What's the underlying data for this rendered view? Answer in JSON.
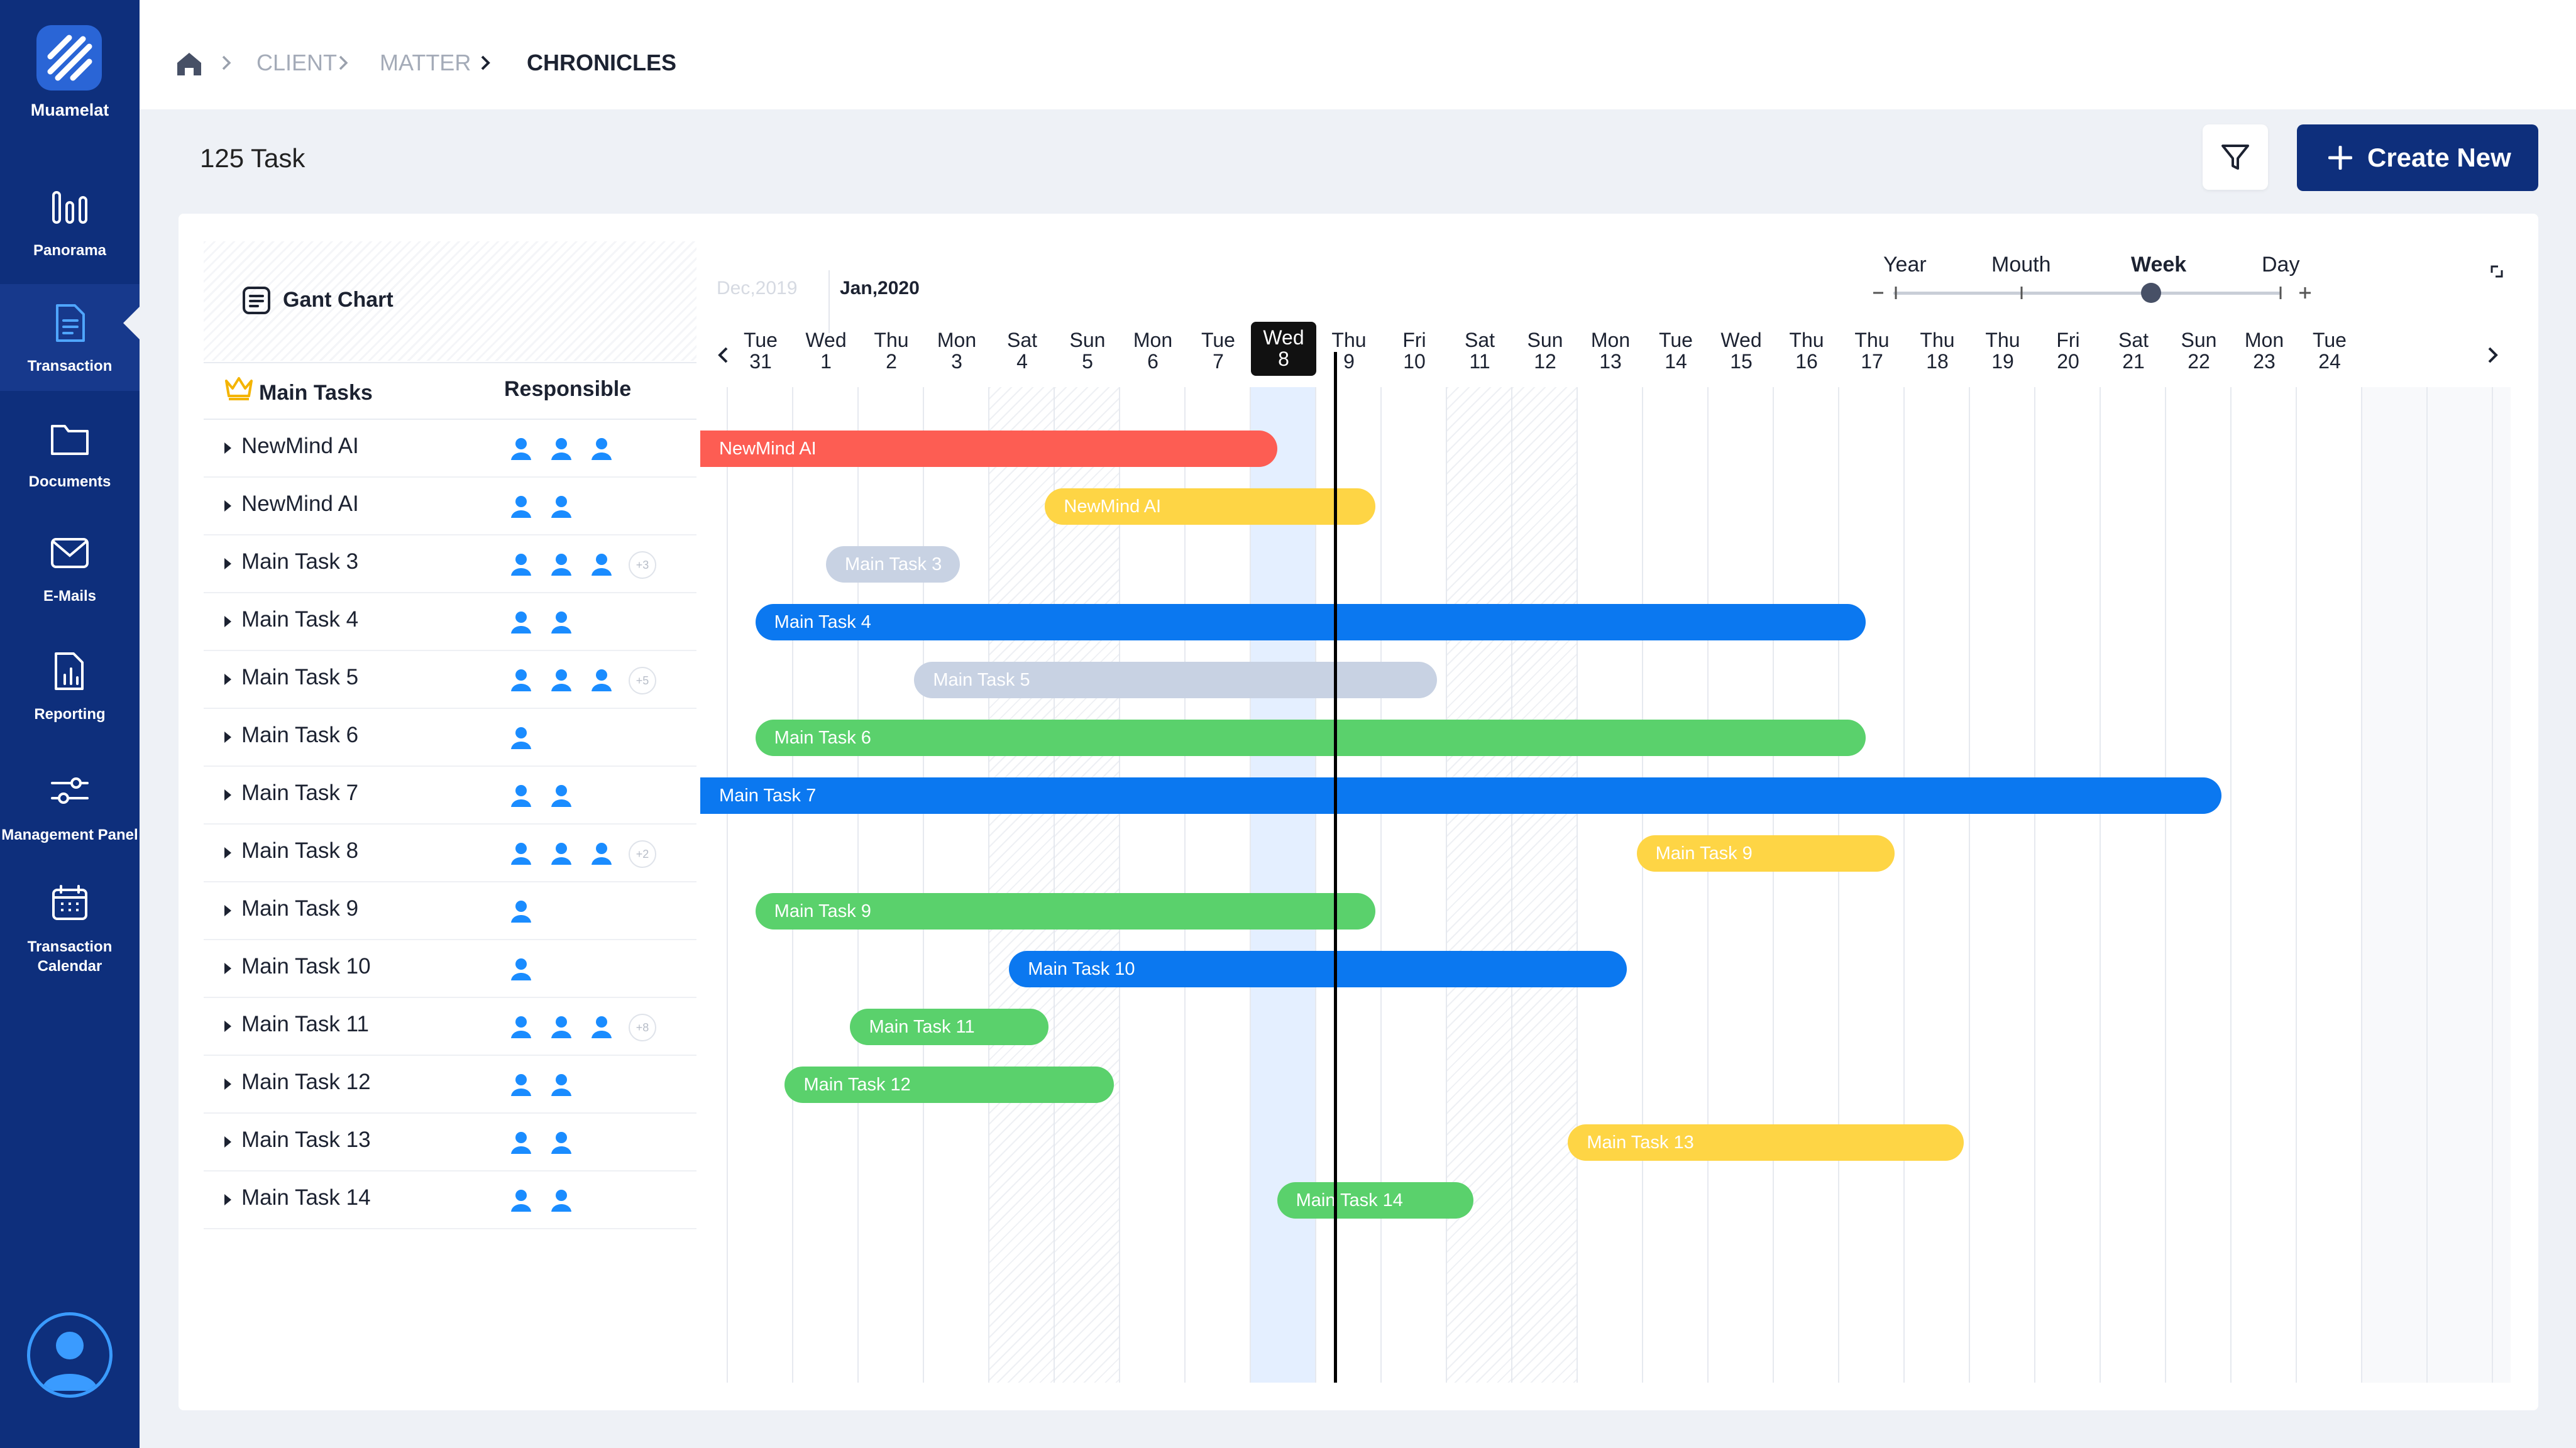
{
  "app": {
    "name": "Muamelat"
  },
  "sidebar": {
    "items": [
      {
        "label": "Panorama",
        "icon": "bar-chart-icon"
      },
      {
        "label": "Transaction",
        "icon": "document-icon"
      },
      {
        "label": "Documents",
        "icon": "folder-icon"
      },
      {
        "label": "E-Mails",
        "icon": "mail-icon"
      },
      {
        "label": "Reporting",
        "icon": "report-icon"
      },
      {
        "label": "Management Panel",
        "icon": "sliders-icon"
      },
      {
        "label": "Transaction Calendar",
        "icon": "calendar-icon"
      }
    ]
  },
  "breadcrumb": {
    "client": "CLIENT",
    "matter": "MATTER",
    "current": "CHRONICLES"
  },
  "toolbar": {
    "task_count": "125 Task",
    "create_label": "Create New"
  },
  "gantt": {
    "panel_title": "Gant Chart",
    "col_main": "Main Tasks",
    "col_responsible": "Responsible",
    "month_prev": "Dec,2019",
    "month_cur": "Jan,2020",
    "scale": {
      "year": "Year",
      "month": "Mouth",
      "week": "Week",
      "day": "Day",
      "selected": "Week"
    },
    "days": [
      {
        "d": "Tue",
        "n": "31"
      },
      {
        "d": "Wed",
        "n": "1"
      },
      {
        "d": "Thu",
        "n": "2"
      },
      {
        "d": "Mon",
        "n": "3"
      },
      {
        "d": "Sat",
        "n": "4"
      },
      {
        "d": "Sun",
        "n": "5"
      },
      {
        "d": "Mon",
        "n": "6"
      },
      {
        "d": "Tue",
        "n": "7"
      },
      {
        "d": "Wed",
        "n": "8"
      },
      {
        "d": "Thu",
        "n": "9"
      },
      {
        "d": "Fri",
        "n": "10"
      },
      {
        "d": "Sat",
        "n": "11"
      },
      {
        "d": "Sun",
        "n": "12"
      },
      {
        "d": "Mon",
        "n": "13"
      },
      {
        "d": "Tue",
        "n": "14"
      },
      {
        "d": "Wed",
        "n": "15"
      },
      {
        "d": "Thu",
        "n": "16"
      },
      {
        "d": "Thu",
        "n": "17"
      },
      {
        "d": "Thu",
        "n": "18"
      },
      {
        "d": "Thu",
        "n": "19"
      },
      {
        "d": "Fri",
        "n": "20"
      },
      {
        "d": "Sat",
        "n": "21"
      },
      {
        "d": "Sun",
        "n": "22"
      },
      {
        "d": "Mon",
        "n": "23"
      },
      {
        "d": "Tue",
        "n": "24"
      }
    ],
    "today_index": 8,
    "weekend_index": [
      4,
      5,
      11,
      12
    ],
    "tasks": [
      {
        "name": "NewMind AI",
        "people": 3,
        "more": "",
        "bar": "NewMind AI",
        "color": "#fd5d53",
        "start": 0,
        "end": 8.4
      },
      {
        "name": "NewMind AI",
        "people": 2,
        "more": "",
        "bar": "NewMind AI",
        "color": "#fed545",
        "start": 4.85,
        "end": 9.9
      },
      {
        "name": "Main Task 3",
        "people": 3,
        "more": "+3",
        "bar": "Main Task 3",
        "color": "#c8d2e3",
        "start": 1.5,
        "end": 3.55
      },
      {
        "name": "Main Task 4",
        "people": 2,
        "more": "",
        "bar": "Main Task 4",
        "color": "#0b78f0",
        "start": 0.42,
        "end": 17.4
      },
      {
        "name": "Main Task 5",
        "people": 3,
        "more": "+5",
        "bar": "Main Task 5",
        "color": "#c8d2e3",
        "start": 2.85,
        "end": 10.85
      },
      {
        "name": "Main Task 6",
        "people": 1,
        "more": "",
        "bar": "Main Task 6",
        "color": "#5ad16c",
        "start": 0.42,
        "end": 17.4
      },
      {
        "name": "Main Task 7",
        "people": 2,
        "more": "",
        "bar": "Main Task 7",
        "color": "#0b78f0",
        "start": 0,
        "end": 22.85
      },
      {
        "name": "Main Task 8",
        "people": 3,
        "more": "+2",
        "bar": "Main Task 9",
        "color": "#fed545",
        "start": 13.9,
        "end": 17.85
      },
      {
        "name": "Main Task 9",
        "people": 1,
        "more": "",
        "bar": "Main Task 9",
        "color": "#5ad16c",
        "start": 0.42,
        "end": 9.9
      },
      {
        "name": "Main Task 10",
        "people": 1,
        "more": "",
        "bar": "Main Task 10",
        "color": "#0b78f0",
        "start": 4.3,
        "end": 13.75
      },
      {
        "name": "Main Task 11",
        "people": 3,
        "more": "+8",
        "bar": "Main Task 11",
        "color": "#5ad16c",
        "start": 1.87,
        "end": 4.9
      },
      {
        "name": "Main Task 12",
        "people": 2,
        "more": "",
        "bar": "Main Task 12",
        "color": "#5ad16c",
        "start": 0.87,
        "end": 5.9
      },
      {
        "name": "Main Task 13",
        "people": 2,
        "more": "",
        "bar": "Main Task 13",
        "color": "#fed545",
        "start": 12.85,
        "end": 18.9
      },
      {
        "name": "Main Task 14",
        "people": 2,
        "more": "",
        "bar": "Main Task 14",
        "color": "#5ad16c",
        "start": 8.4,
        "end": 11.4
      }
    ]
  }
}
